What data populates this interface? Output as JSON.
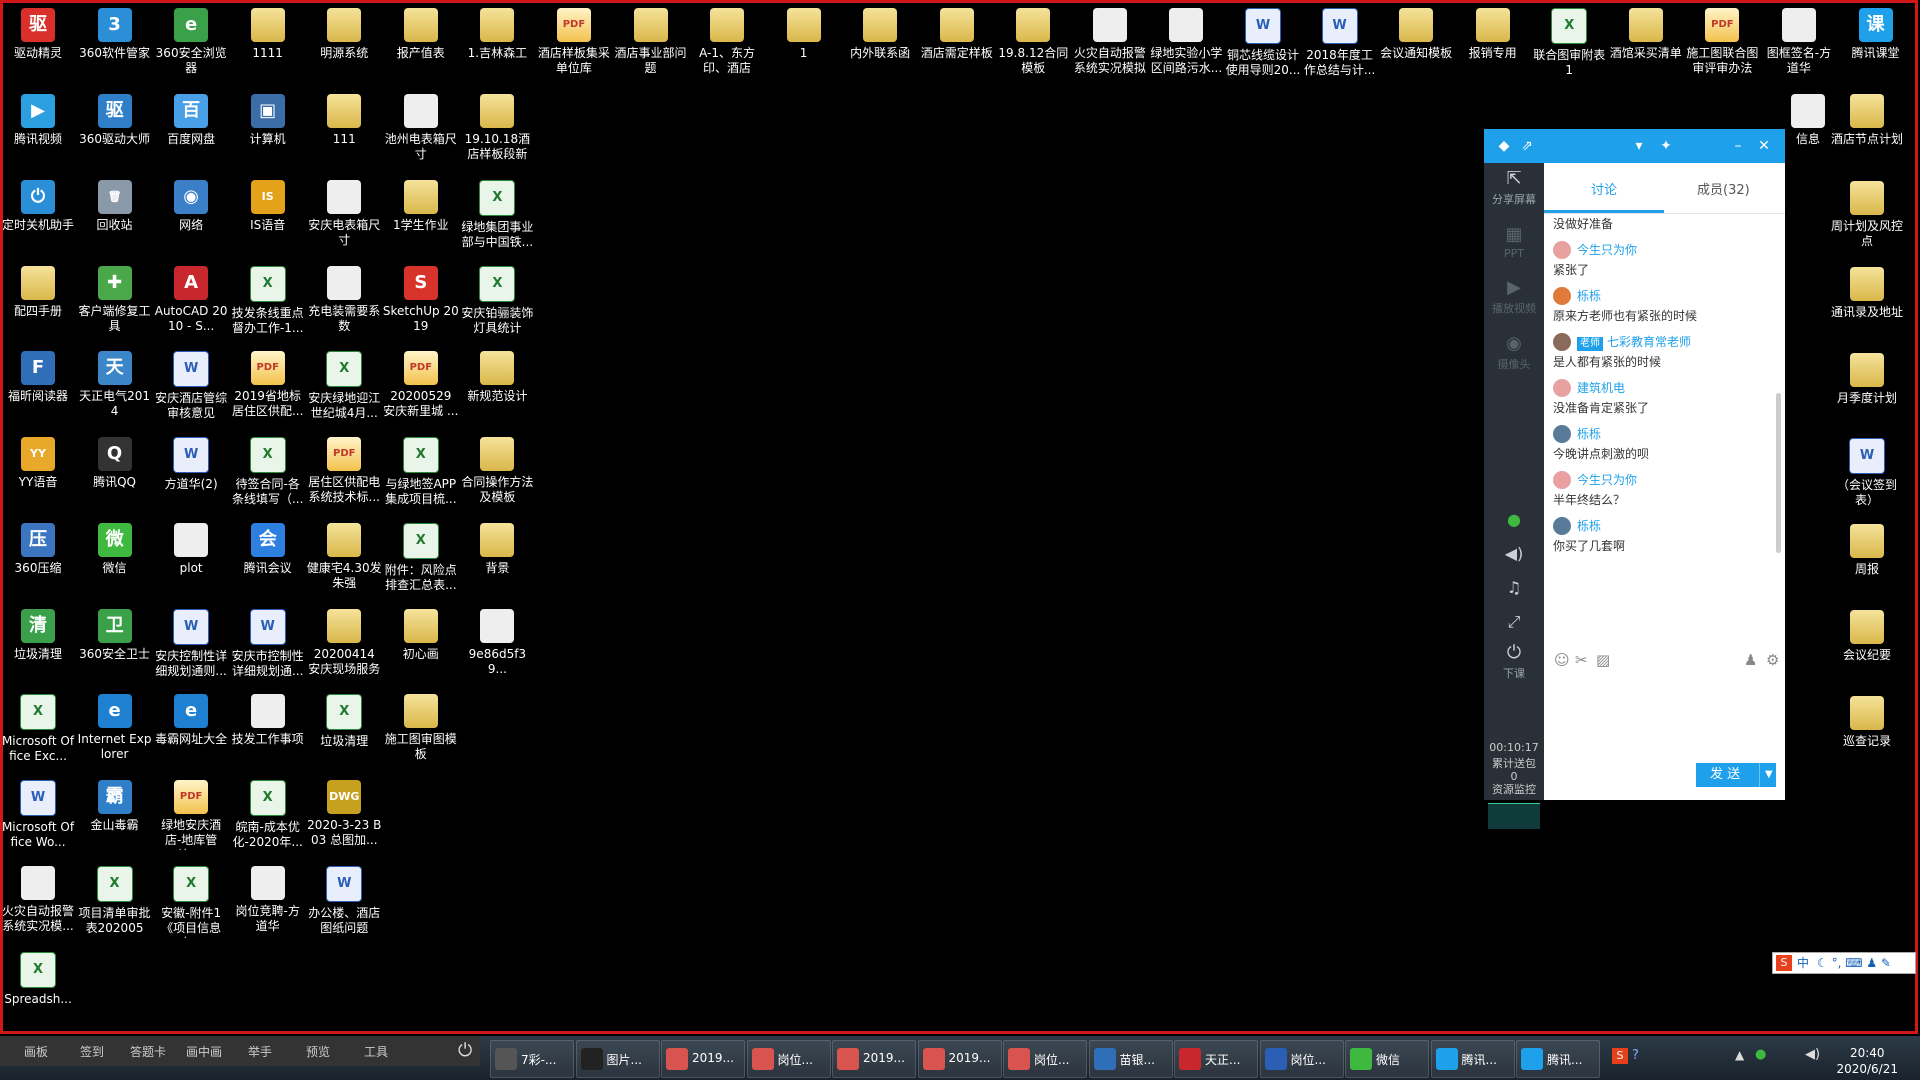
{
  "desktop": {
    "icons": [
      {
        "label": "驱动精灵",
        "type": "app",
        "color": "#d9302b",
        "glyph": "驱"
      },
      {
        "label": "360软件管家",
        "type": "app",
        "color": "#2a8fd6",
        "glyph": "3"
      },
      {
        "label": "360安全浏览器",
        "type": "app",
        "color": "#3aa14a",
        "glyph": "e"
      },
      {
        "label": "1111",
        "type": "folder"
      },
      {
        "label": "明源系统",
        "type": "folder"
      },
      {
        "label": "报产值表",
        "type": "folder"
      },
      {
        "label": "1.吉林森工",
        "type": "folder"
      },
      {
        "label": "酒店样板集采单位库",
        "type": "pdf"
      },
      {
        "label": "酒店事业部问题",
        "type": "folder"
      },
      {
        "label": "A-1、东方印、酒店",
        "type": "folder"
      },
      {
        "label": "1",
        "type": "folder"
      },
      {
        "label": "内外联系函",
        "type": "folder"
      },
      {
        "label": "酒店需定样板",
        "type": "folder"
      },
      {
        "label": "19.8.12合同模板",
        "type": "folder"
      },
      {
        "label": "火灾自动报警系统实况模拟",
        "type": "img"
      },
      {
        "label": "绿地实验小学区间路污水...",
        "type": "img"
      },
      {
        "label": "铜芯线缆设计使用导则20...",
        "type": "word"
      },
      {
        "label": "2018年度工作总结与计...",
        "type": "word"
      },
      {
        "label": "会议通知模板",
        "type": "folder"
      },
      {
        "label": "报销专用",
        "type": "folder"
      },
      {
        "label": "联合图审附表1",
        "type": "xls"
      },
      {
        "label": "酒馆采买清单",
        "type": "folder"
      },
      {
        "label": "施工图联合图审评审办法",
        "type": "pdf"
      },
      {
        "label": "图框签名-方道华",
        "type": "img"
      },
      {
        "label": "腾讯课堂",
        "type": "app",
        "color": "#1ea0ea",
        "glyph": "课"
      },
      {
        "label": "腾讯视频",
        "type": "app",
        "color": "#2b9fe0",
        "glyph": "▶"
      },
      {
        "label": "360驱动大师",
        "type": "app",
        "color": "#2f7fc8",
        "glyph": "驱"
      },
      {
        "label": "百度网盘",
        "type": "app",
        "color": "#4aa0e6",
        "glyph": "百"
      },
      {
        "label": "计算机",
        "type": "app",
        "color": "#3b6ea8",
        "glyph": "▣"
      },
      {
        "label": "111",
        "type": "folder"
      },
      {
        "label": "池州电表箱尺寸",
        "type": "img"
      },
      {
        "label": "19.10.18酒店样板段新",
        "type": "folder"
      },
      {
        "label": "定时关机助手",
        "type": "app",
        "color": "#2a8fd6",
        "glyph": "⏻"
      },
      {
        "label": "回收站",
        "type": "app",
        "color": "#8a99a8",
        "glyph": "🗑"
      },
      {
        "label": "网络",
        "type": "app",
        "color": "#3a7fc8",
        "glyph": "◉"
      },
      {
        "label": "IS语音",
        "type": "app",
        "color": "#e3a21a",
        "glyph": "IS"
      },
      {
        "label": "安庆电表箱尺寸",
        "type": "img"
      },
      {
        "label": "1学生作业",
        "type": "folder"
      },
      {
        "label": "绿地集团事业部与中国铁...",
        "type": "xls"
      },
      {
        "label": "配四手册",
        "type": "folder"
      },
      {
        "label": "客户端修复工具",
        "type": "app",
        "color": "#4aa84a",
        "glyph": "✚"
      },
      {
        "label": "AutoCAD 2010 - S...",
        "type": "app",
        "color": "#c8282d",
        "glyph": "A"
      },
      {
        "label": "技发条线重点督办工作-1...",
        "type": "xls"
      },
      {
        "label": "充电装需要系数",
        "type": "img"
      },
      {
        "label": "SketchUp 2019",
        "type": "app",
        "color": "#d8332b",
        "glyph": "S"
      },
      {
        "label": "安庆铂骊装饰灯具统计",
        "type": "xls"
      },
      {
        "label": "福昕阅读器",
        "type": "app",
        "color": "#2f6fb8",
        "glyph": "F"
      },
      {
        "label": "天正电气2014",
        "type": "app",
        "color": "#3a86c8",
        "glyph": "天"
      },
      {
        "label": "安庆酒店管综审核意见",
        "type": "word"
      },
      {
        "label": "2019省地标居住区供配...",
        "type": "pdf"
      },
      {
        "label": "安庆绿地迎江世纪城4月...",
        "type": "xls"
      },
      {
        "label": "20200529 安庆新里城 ...",
        "type": "pdf"
      },
      {
        "label": "新规范设计",
        "type": "folder"
      },
      {
        "label": "YY语音",
        "type": "app",
        "color": "#e8a92a",
        "glyph": "YY"
      },
      {
        "label": "腾讯QQ",
        "type": "app",
        "color": "#333333",
        "glyph": "Q"
      },
      {
        "label": "方道华(2)",
        "type": "word"
      },
      {
        "label": "待签合同-各条线填写（...",
        "type": "xls"
      },
      {
        "label": "居住区供配电系统技术标...",
        "type": "pdf"
      },
      {
        "label": "与绿地签APP集成项目梳...",
        "type": "xls"
      },
      {
        "label": "合同操作方法及模板",
        "type": "folder"
      },
      {
        "label": "360压缩",
        "type": "app",
        "color": "#3b75c0",
        "glyph": "压"
      },
      {
        "label": "微信",
        "type": "app",
        "color": "#3fb83f",
        "glyph": "微"
      },
      {
        "label": "plot",
        "type": "img"
      },
      {
        "label": "腾讯会议",
        "type": "app",
        "color": "#2d7fe0",
        "glyph": "会"
      },
      {
        "label": "健康宅4.30发朱强",
        "type": "folder"
      },
      {
        "label": "附件：风险点排查汇总表...",
        "type": "xls"
      },
      {
        "label": "背景",
        "type": "folder"
      },
      {
        "label": "垃圾清理",
        "type": "app",
        "color": "#3aa14a",
        "glyph": "清"
      },
      {
        "label": "360安全卫士",
        "type": "app",
        "color": "#3aa14a",
        "glyph": "卫"
      },
      {
        "label": "安庆控制性详细规划通则...",
        "type": "word"
      },
      {
        "label": "安庆市控制性详细规划通...",
        "type": "word"
      },
      {
        "label": "20200414 安庆现场服务",
        "type": "folder"
      },
      {
        "label": "初心画",
        "type": "folder"
      },
      {
        "label": "9e86d5f39...",
        "type": "img"
      },
      {
        "label": "Microsoft Office Exc...",
        "type": "xls"
      },
      {
        "label": "Internet Explorer",
        "type": "app",
        "color": "#1f7fd0",
        "glyph": "e"
      },
      {
        "label": "毒霸网址大全",
        "type": "app",
        "color": "#1f7fd0",
        "glyph": "e"
      },
      {
        "label": "技发工作事项",
        "type": "img"
      },
      {
        "label": "垃圾清理",
        "type": "xls"
      },
      {
        "label": "施工图审图模板",
        "type": "folder"
      },
      {
        "label": "Microsoft Office Wo...",
        "type": "word"
      },
      {
        "label": "金山毒霸",
        "type": "app",
        "color": "#2f7fc8",
        "glyph": "霸"
      },
      {
        "label": "绿地安庆酒店-地库管综-...",
        "type": "pdf"
      },
      {
        "label": "皖南-成本优化-2020年...",
        "type": "xls"
      },
      {
        "label": "2020-3-23 B03 总图加...",
        "type": "app",
        "color": "#c8a020",
        "glyph": "DWG"
      },
      {
        "label": "火灾自动报警系统实况模...",
        "type": "img"
      },
      {
        "label": "项目清单审批表2020051...",
        "type": "xls"
      },
      {
        "label": "安徽-附件1《项目信息申...",
        "type": "xls"
      },
      {
        "label": "岗位竞聘-方道华",
        "type": "img"
      },
      {
        "label": "办公楼、酒店图纸问题",
        "type": "word"
      },
      {
        "label": "Spreadsh...",
        "type": "xls"
      },
      {
        "label": "信息",
        "type": "img"
      },
      {
        "label": "酒店节点计划",
        "type": "folder"
      },
      {
        "label": "周计划及风控点",
        "type": "folder"
      },
      {
        "label": "通讯录及地址",
        "type": "folder"
      },
      {
        "label": "月季度计划",
        "type": "folder"
      },
      {
        "label": "（会议签到表）",
        "type": "word"
      },
      {
        "label": "周报",
        "type": "folder"
      },
      {
        "label": "会议纪要",
        "type": "folder"
      },
      {
        "label": "巡查记录",
        "type": "folder"
      }
    ]
  },
  "classroom": {
    "title_icons": [
      "tencent-class-icon",
      "share-out-icon",
      "dropdown-icon",
      "pin-icon",
      "minimize-icon",
      "close-icon"
    ],
    "tools": [
      {
        "label": "分享屏幕",
        "icon": "share-screen-icon",
        "glyph": "⇱",
        "active": true
      },
      {
        "label": "PPT",
        "icon": "ppt-icon",
        "glyph": "▦",
        "active": false
      },
      {
        "label": "播放视频",
        "icon": "play-video-icon",
        "glyph": "▶",
        "active": false
      },
      {
        "label": "摄像头",
        "icon": "camera-icon",
        "glyph": "◉",
        "active": false
      }
    ],
    "media_icons": [
      "microphone-icon",
      "speaker-icon",
      "music-icon",
      "fullscreen-icon"
    ],
    "end_class_label": "下课",
    "timer": "00:10:17",
    "gift_label": "累计送包",
    "gift_count": "0",
    "monitor_label": "资源监控",
    "tabs": {
      "discuss": "讨论",
      "members": "成员(32)"
    },
    "messages": [
      {
        "name": "",
        "text": "没做好准备"
      },
      {
        "name": "今生只为你",
        "text": "紧张了"
      },
      {
        "name": "栎栎",
        "text": "原来方老师也有紧张的时候"
      },
      {
        "name": "七彩教育常老师",
        "badge": "老师",
        "text": "是人都有紧张的时候"
      },
      {
        "name": "建筑机电",
        "text": "没准备肯定紧张了"
      },
      {
        "name": "栎栎",
        "text": "今晚讲点刺激的呗"
      },
      {
        "name": "今生只为你",
        "text": "半年终结么？"
      },
      {
        "name": "栎栎",
        "text": "你买了几套啊"
      }
    ],
    "input_icons": [
      "emoji-icon",
      "scissors-icon",
      "image-icon",
      "user-manage-icon",
      "settings-icon"
    ],
    "send_label": "发 送"
  },
  "taskbar": {
    "tools": [
      "画板",
      "签到",
      "答题卡",
      "画中画",
      "举手",
      "预览",
      "工具"
    ],
    "buttons": [
      {
        "label": "7彩-...",
        "color": "#555"
      },
      {
        "label": "图片...",
        "color": "#222"
      },
      {
        "label": "2019...",
        "color": "#d9534f"
      },
      {
        "label": "岗位...",
        "color": "#d9534f"
      },
      {
        "label": "2019...",
        "color": "#d9534f"
      },
      {
        "label": "2019...",
        "color": "#d9534f"
      },
      {
        "label": "岗位...",
        "color": "#d9534f"
      },
      {
        "label": "苗银...",
        "color": "#2f6fb8"
      },
      {
        "label": "天正...",
        "color": "#c8282d"
      },
      {
        "label": "岗位...",
        "color": "#2b5fb5"
      },
      {
        "label": "微信",
        "color": "#3fb83f"
      },
      {
        "label": "腾讯...",
        "color": "#1ea0ea"
      },
      {
        "label": "腾讯...",
        "color": "#1ea0ea"
      }
    ],
    "clock": {
      "time": "20:40",
      "date": "2020/6/21"
    }
  },
  "ime": {
    "label": "中"
  }
}
